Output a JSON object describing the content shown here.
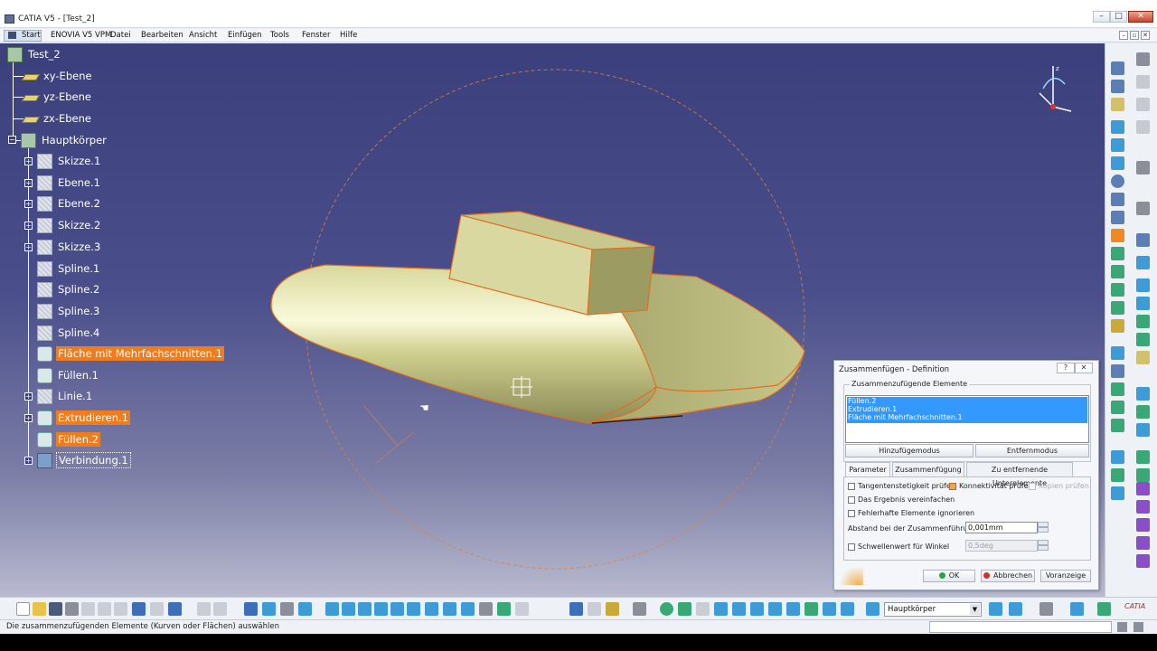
{
  "window": {
    "title": "CATIA V5 - [Test_2]"
  },
  "menu": {
    "start": "Start",
    "items": [
      "ENOVIA V5 VPM",
      "Datei",
      "Bearbeiten",
      "Ansicht",
      "Einfügen",
      "Tools",
      "Fenster",
      "Hilfe"
    ]
  },
  "tree": {
    "root": "Test_2",
    "planes": [
      "xy-Ebene",
      "yz-Ebene",
      "zx-Ebene"
    ],
    "body": "Hauptkörper",
    "features": [
      {
        "label": "Skizze.1",
        "icon": "sketch-icon",
        "state": "normal"
      },
      {
        "label": "Ebene.1",
        "icon": "plane-icon",
        "state": "normal"
      },
      {
        "label": "Ebene.2",
        "icon": "plane-icon",
        "state": "normal"
      },
      {
        "label": "Skizze.2",
        "icon": "sketch-icon",
        "state": "normal"
      },
      {
        "label": "Skizze.3",
        "icon": "sketch-icon",
        "state": "normal"
      },
      {
        "label": "Spline.1",
        "icon": "spline-icon",
        "state": "normal"
      },
      {
        "label": "Spline.2",
        "icon": "spline-icon",
        "state": "normal"
      },
      {
        "label": "Spline.3",
        "icon": "spline-icon",
        "state": "normal"
      },
      {
        "label": "Spline.4",
        "icon": "spline-icon",
        "state": "normal"
      },
      {
        "label": "Fläche mit Mehrfachschnitten.1",
        "icon": "multi-section-surface-icon",
        "state": "highlight"
      },
      {
        "label": "Füllen.1",
        "icon": "fill-icon",
        "state": "normal"
      },
      {
        "label": "Linie.1",
        "icon": "line-icon",
        "state": "normal"
      },
      {
        "label": "Extrudieren.1",
        "icon": "extrude-icon",
        "state": "highlight"
      },
      {
        "label": "Füllen.2",
        "icon": "fill-icon",
        "state": "highlight"
      },
      {
        "label": "Verbindung.1",
        "icon": "join-icon",
        "state": "selected"
      }
    ]
  },
  "dialog": {
    "title": "Zusammenfügen - Definition",
    "help": "?",
    "close": "✕",
    "group_label": "Zusammenzufügende Elemente",
    "elements": [
      "Füllen.2",
      "Extrudieren.1",
      "Fläche mit Mehrfachschnitten.1"
    ],
    "add_mode": "Hinzufügemodus",
    "remove_mode": "Entfernmodus",
    "tabs": [
      "Parameter",
      "Zusammenfügung",
      "Zu entfernende Unterelemente"
    ],
    "checks": {
      "tangency": "Tangentenstetigkeit prüfen",
      "connectivity": "Konnektivität prüfen",
      "copy": "Kopien prüfen",
      "simplify": "Das Ergebnis vereinfachen",
      "ignore": "Fehlerhafte Elemente ignorieren",
      "angle": "Schwellenwert für Winkel"
    },
    "distance_label": "Abstand bei der Zusammenführung",
    "distance_value": "0,001mm",
    "angle_value": "0,5deg",
    "ok": "OK",
    "cancel": "Abbrechen",
    "preview": "Voranzeige"
  },
  "toolbar": {
    "body_combo": "Hauptkörper"
  },
  "status": {
    "text": "Die zusammenzufügenden Elemente (Kurven oder Flächen) auswählen"
  },
  "colors": {
    "viewport_top": "#3b3f7c",
    "highlight": "#f07d1d",
    "part": "#e6e6a8",
    "selection_list": "#3399ff"
  }
}
